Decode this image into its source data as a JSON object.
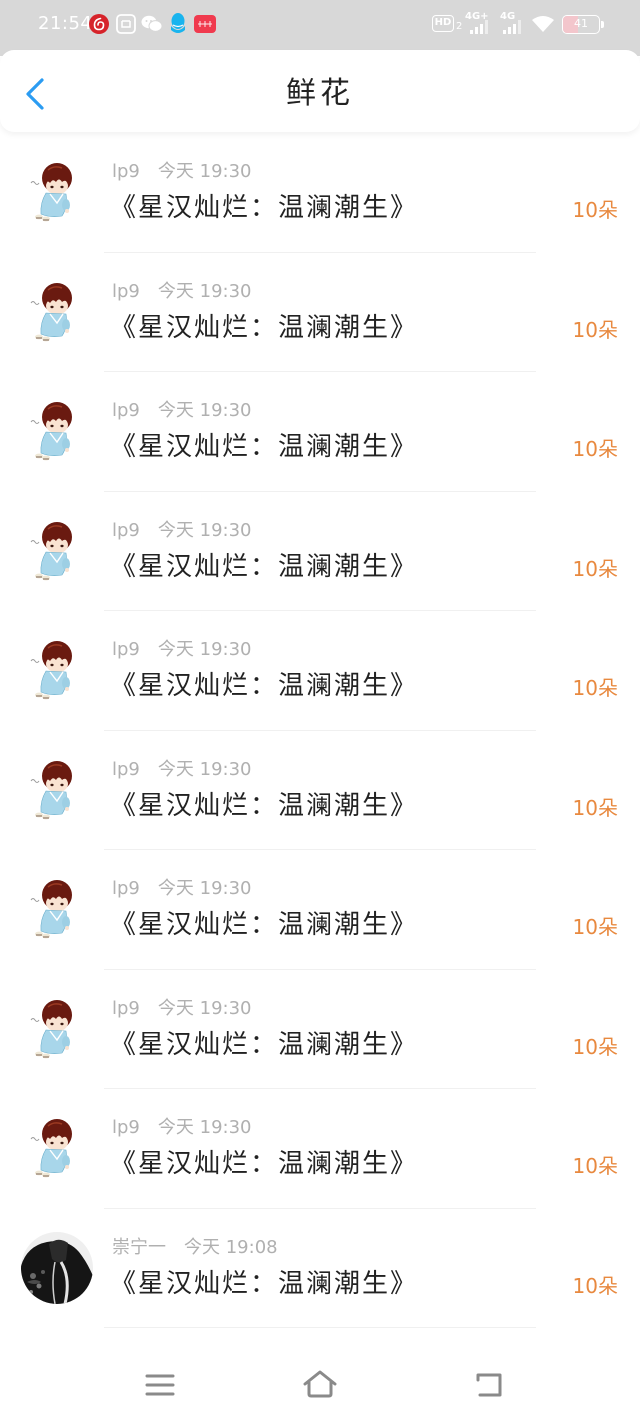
{
  "status_bar": {
    "time": "21:54",
    "notification_icons": [
      "netease-cloud-music-icon",
      "square-app-icon",
      "wechat-icon",
      "qq-icon",
      "red-app-icon"
    ],
    "hd_label": "HD",
    "hd_sub": "2",
    "sim1_network": "4G+",
    "sim2_network": "4G",
    "battery_level": "41",
    "icons": [
      "signal-icon",
      "wifi-icon",
      "battery-icon"
    ]
  },
  "header": {
    "back_icon": "chevron-left-icon",
    "title": "鲜花"
  },
  "colors": {
    "accent": "#2b9cf2",
    "count": "#e8893f",
    "meta": "#b0b0b0",
    "title": "#222222",
    "status_bar": "#d8d8d8"
  },
  "gifts": [
    {
      "user": "lp9",
      "time": "今天 19:30",
      "title": "《星汉灿烂：温澜潮生》",
      "count": "10朵",
      "avatar_icon": "chibi-character-avatar"
    },
    {
      "user": "lp9",
      "time": "今天 19:30",
      "title": "《星汉灿烂：温澜潮生》",
      "count": "10朵",
      "avatar_icon": "chibi-character-avatar"
    },
    {
      "user": "lp9",
      "time": "今天 19:30",
      "title": "《星汉灿烂：温澜潮生》",
      "count": "10朵",
      "avatar_icon": "chibi-character-avatar"
    },
    {
      "user": "lp9",
      "time": "今天 19:30",
      "title": "《星汉灿烂：温澜潮生》",
      "count": "10朵",
      "avatar_icon": "chibi-character-avatar"
    },
    {
      "user": "lp9",
      "time": "今天 19:30",
      "title": "《星汉灿烂：温澜潮生》",
      "count": "10朵",
      "avatar_icon": "chibi-character-avatar"
    },
    {
      "user": "lp9",
      "time": "今天 19:30",
      "title": "《星汉灿烂：温澜潮生》",
      "count": "10朵",
      "avatar_icon": "chibi-character-avatar"
    },
    {
      "user": "lp9",
      "time": "今天 19:30",
      "title": "《星汉灿烂：温澜潮生》",
      "count": "10朵",
      "avatar_icon": "chibi-character-avatar"
    },
    {
      "user": "lp9",
      "time": "今天 19:30",
      "title": "《星汉灿烂：温澜潮生》",
      "count": "10朵",
      "avatar_icon": "chibi-character-avatar"
    },
    {
      "user": "lp9",
      "time": "今天 19:30",
      "title": "《星汉灿烂：温澜潮生》",
      "count": "10朵",
      "avatar_icon": "chibi-character-avatar"
    },
    {
      "user": "崇宁一",
      "time": "今天 19:08",
      "title": "《星汉灿烂：温澜潮生》",
      "count": "10朵",
      "avatar_icon": "dark-portrait-avatar"
    }
  ],
  "nav_bar": {
    "icons": [
      "menu-icon",
      "home-icon",
      "back-icon"
    ]
  }
}
